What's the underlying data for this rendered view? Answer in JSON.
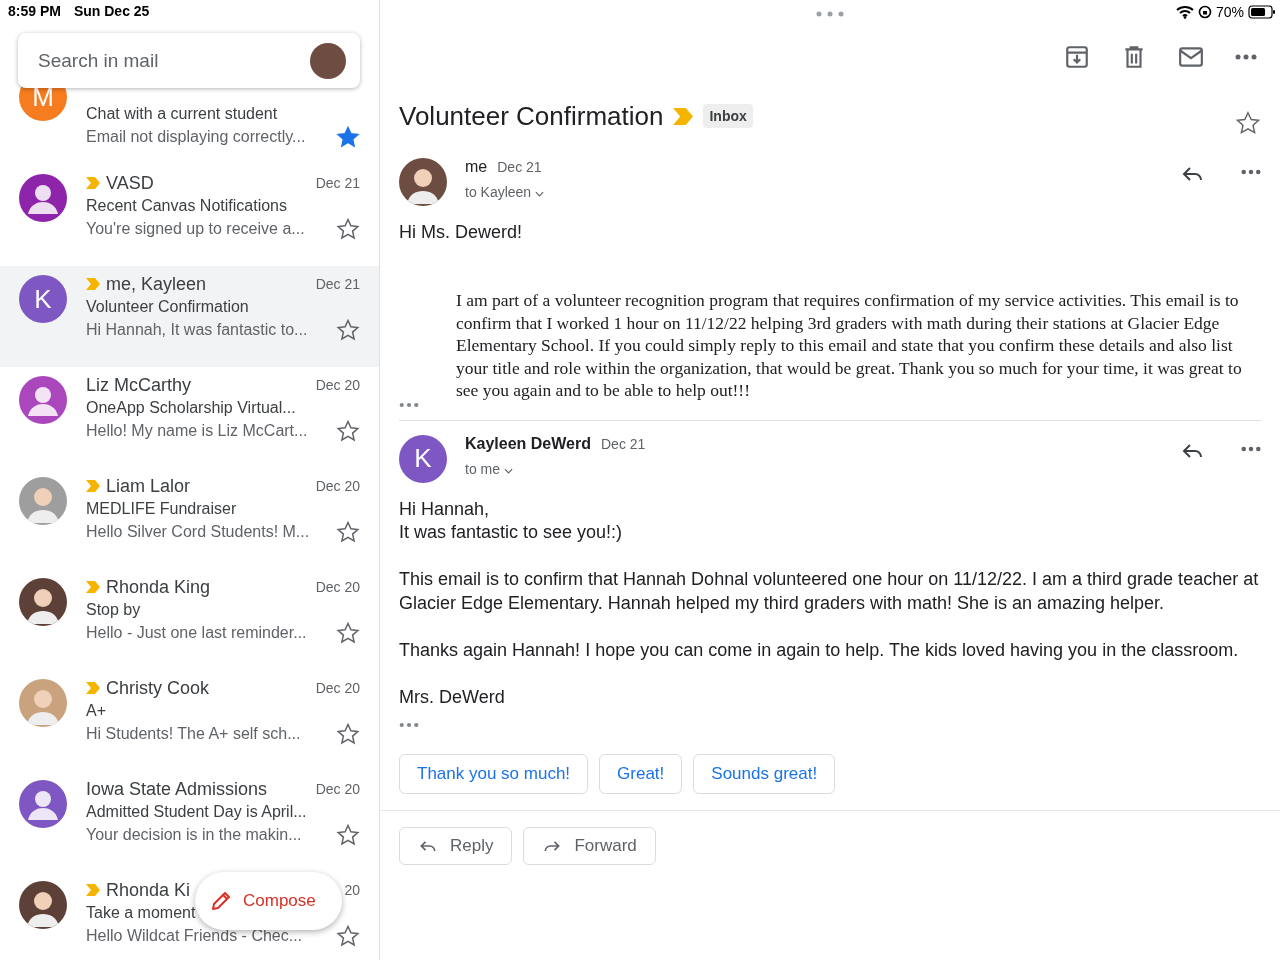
{
  "status_bar": {
    "time": "8:59 PM",
    "date": "Sun Dec 25",
    "battery": "70%"
  },
  "search": {
    "placeholder": "Search in mail"
  },
  "threads": [
    {
      "avatar": {
        "kind": "letter",
        "letter": "M",
        "color": "#f57c1f"
      },
      "subject": "Chat with a current student",
      "snippet": "Email not displaying correctly...",
      "starred": true,
      "selected": false
    },
    {
      "avatar": {
        "kind": "person",
        "color": "#8e24aa"
      },
      "sender": "VASD",
      "date": "Dec 21",
      "subject": "Recent Canvas Notifications",
      "snippet": "You're signed up to receive a...",
      "starred": false,
      "important": true,
      "selected": false
    },
    {
      "avatar": {
        "kind": "letter",
        "letter": "K",
        "color": "#7e57c2"
      },
      "sender": "me, Kayleen",
      "date": "Dec 21",
      "subject": "Volunteer Confirmation",
      "snippet": "Hi Hannah, It was fantastic to...",
      "starred": false,
      "important": true,
      "selected": true
    },
    {
      "avatar": {
        "kind": "person",
        "color": "#ab47bc"
      },
      "sender": "Liz McCarthy",
      "date": "Dec 20",
      "subject": "OneApp Scholarship Virtual...",
      "snippet": "Hello! My name is Liz McCart...",
      "starred": false,
      "important": false,
      "selected": false
    },
    {
      "avatar": {
        "kind": "photo",
        "color": "#9e9e9e"
      },
      "sender": "Liam Lalor",
      "date": "Dec 20",
      "subject": "MEDLIFE Fundraiser",
      "snippet": "Hello Silver Cord Students! M...",
      "starred": false,
      "important": true,
      "selected": false
    },
    {
      "avatar": {
        "kind": "photo",
        "color": "#5d4037"
      },
      "sender": "Rhonda King",
      "date": "Dec 20",
      "subject": "Stop by",
      "snippet": "Hello - Just one last reminder...",
      "starred": false,
      "important": true,
      "selected": false
    },
    {
      "avatar": {
        "kind": "photo",
        "color": "#c9a27e"
      },
      "sender": "Christy Cook",
      "date": "Dec 20",
      "subject": "A+",
      "snippet": "Hi Students! The A+ self sch...",
      "starred": false,
      "important": true,
      "selected": false
    },
    {
      "avatar": {
        "kind": "person",
        "color": "#7e57c2"
      },
      "sender": "Iowa State Admissions",
      "date": "Dec 20",
      "subject": "Admitted Student Day is April...",
      "snippet": "Your decision is in the makin...",
      "starred": false,
      "important": false,
      "selected": false
    },
    {
      "avatar": {
        "kind": "photo",
        "color": "#5d4037"
      },
      "sender": "Rhonda Ki",
      "date": "20",
      "subject": "Take a moment",
      "snippet": "Hello Wildcat Friends - Chec...",
      "starred": false,
      "important": true,
      "selected": false
    }
  ],
  "compose": {
    "label": "Compose"
  },
  "conversation": {
    "title": "Volunteer Confirmation",
    "important": true,
    "label": "Inbox",
    "starred": false,
    "messages": [
      {
        "avatar": {
          "kind": "photo",
          "color": "#6d4c41"
        },
        "sender": "me",
        "date": "Dec 21",
        "to": "to Kayleen",
        "bold": false,
        "serif": true,
        "greeting": "Hi Ms. Dewerd!",
        "paragraphs": [
          "I am part of a volunteer recognition program that requires confirmation of my service activities. This email is to confirm that I worked 1 hour on 11/12/22 helping 3rd graders with math during their stations at Glacier Edge Elementary School. If you could simply reply to this email and state that you confirm these details and also list your title and role within the organization, that would be great. Thank you so much for your time, it was great to see you again and to be able to help out!!!"
        ]
      },
      {
        "avatar": {
          "kind": "letter",
          "letter": "K",
          "color": "#7e57c2"
        },
        "sender": "Kayleen DeWerd",
        "date": "Dec 21",
        "to": "to me",
        "bold": true,
        "serif": false,
        "greeting": "Hi Hannah,",
        "paragraphs": [
          "It was fantastic to see you!:)",
          "This email is to confirm that Hannah Dohnal volunteered one hour on 11/12/22. I am a third grade teacher at Glacier Edge Elementary. Hannah helped my third graders with math!  She is an amazing helper.",
          "Thanks again Hannah! I hope you can come in again to help. The kids loved having you in the classroom.",
          "Mrs. DeWerd"
        ]
      }
    ],
    "smart_replies": [
      "Thank you so much!",
      "Great!",
      "Sounds great!"
    ],
    "actions": [
      {
        "kind": "reply",
        "label": "Reply"
      },
      {
        "kind": "forward",
        "label": "Forward"
      }
    ]
  }
}
